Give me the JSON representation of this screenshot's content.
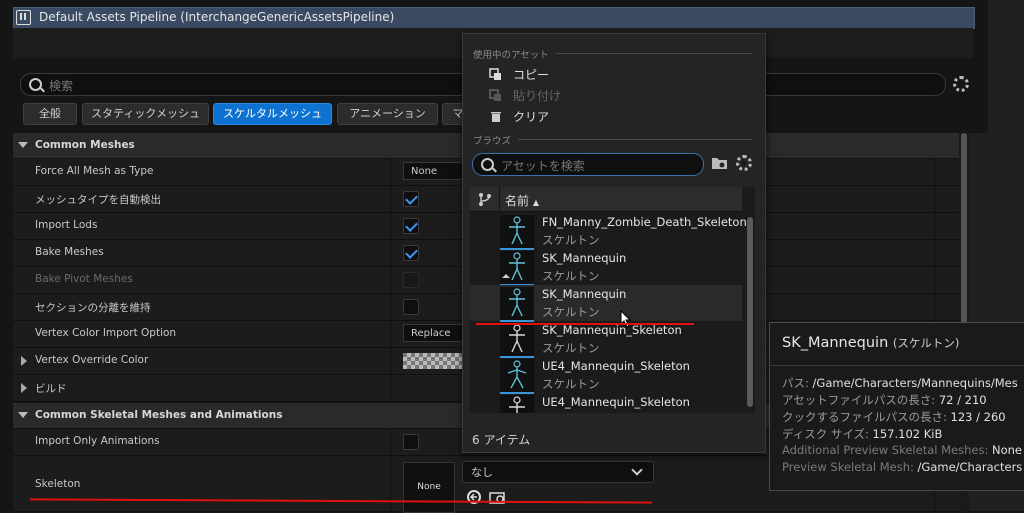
{
  "window": {
    "title": "Default Assets Pipeline (InterchangeGenericAssetsPipeline)"
  },
  "search": {
    "placeholder": "検索"
  },
  "tabs": [
    {
      "label": "全般",
      "active": false
    },
    {
      "label": "スタティックメッシュ",
      "active": false
    },
    {
      "label": "スケルタルメッシュ",
      "active": true
    },
    {
      "label": "アニメーション",
      "active": false
    },
    {
      "label": "マ",
      "active": false
    }
  ],
  "sections": {
    "common_meshes": "Common Meshes",
    "common_skeletal": "Common Skeletal Meshes and Animations"
  },
  "rows": {
    "force_all_mesh": {
      "label": "Force All Mesh as Type",
      "value": "None"
    },
    "auto_detect": {
      "label": "メッシュタイプを自動検出",
      "checked": true
    },
    "import_lods": {
      "label": "Import Lods",
      "checked": true
    },
    "bake_meshes": {
      "label": "Bake Meshes",
      "checked": true
    },
    "bake_pivot": {
      "label": "Bake Pivot Meshes",
      "checked": false
    },
    "keep_sections": {
      "label": "セクションの分離を維持",
      "checked": false
    },
    "vertex_color_import": {
      "label": "Vertex Color Import Option",
      "value": "Replace"
    },
    "vertex_override": {
      "label": "Vertex Override Color"
    },
    "build": {
      "label": "ビルド"
    },
    "import_only_anim": {
      "label": "Import Only Animations",
      "checked": false
    },
    "skeleton": {
      "label": "Skeleton",
      "thumb": "None",
      "value": "なし"
    }
  },
  "popup": {
    "in_use_header": "使用中のアセット",
    "copy": "コピー",
    "paste": "貼り付け",
    "clear": "クリア",
    "browse_header": "ブラウズ",
    "search_placeholder": "アセットを検索",
    "column_name": "名前",
    "items": [
      {
        "name": "FN_Manny_Zombie_Death_Skeleton",
        "type": "スケルトン"
      },
      {
        "name": "SK_Mannequin",
        "type": "スケルトン"
      },
      {
        "name": "SK_Mannequin",
        "type": "スケルトン"
      },
      {
        "name": "SK_Mannequin_Skeleton",
        "type": "スケルトン"
      },
      {
        "name": "UE4_Mannequin_Skeleton",
        "type": "スケルトン"
      },
      {
        "name": "UE4_Mannequin_Skeleton",
        "type": "スケルトン"
      }
    ],
    "count": "6 アイテム"
  },
  "tooltip": {
    "name": "SK_Mannequin",
    "type": "(スケルトン)",
    "lines": [
      {
        "k": "パス: ",
        "v": "/Game/Characters/Mannequins/Mes"
      },
      {
        "k": "アセットファイルパスの長さ: ",
        "v": "72 / 210"
      },
      {
        "k": "クックするファイルパスの長さ: ",
        "v": "123 / 260"
      },
      {
        "k": "ディスク サイズ: ",
        "v": "157.102 KiB"
      },
      {
        "k": "Additional Preview Skeletal Meshes: ",
        "v": "None"
      },
      {
        "k": "Preview Skeletal Mesh: ",
        "v": "/Game/Characters"
      }
    ]
  },
  "colors": {
    "accent": "#0e73d0",
    "annotation_red": "#e01010",
    "thumb_underline": "#3a95d8"
  }
}
